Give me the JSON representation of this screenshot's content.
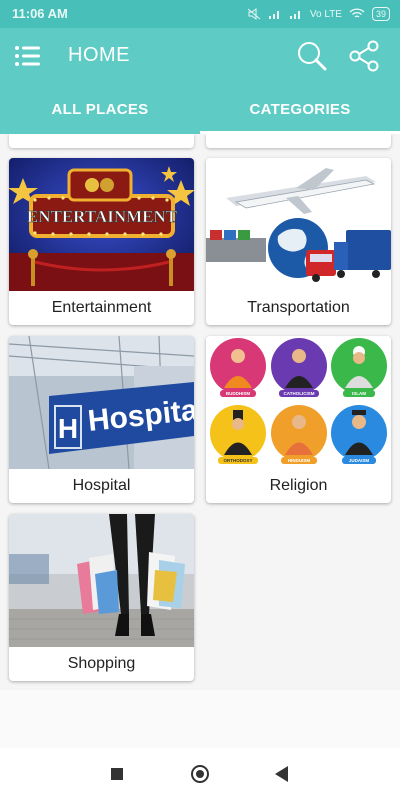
{
  "status_bar": {
    "time": "11:06 AM",
    "battery": "39",
    "network": "Vo LTE"
  },
  "toolbar": {
    "title": "HOME"
  },
  "tabs": [
    {
      "label": "ALL PLACES"
    },
    {
      "label": "CATEGORIES"
    }
  ],
  "colors": {
    "accent": "#5ecbc4",
    "status": "#48bfb8"
  },
  "categories": [
    {
      "label": "Entertainment",
      "banner": "ENTERTAINMENT"
    },
    {
      "label": "Transportation"
    },
    {
      "label": "Hospital",
      "sign": "Hospital"
    },
    {
      "label": "Religion",
      "tags": [
        "BUDDHISM",
        "CATHOLICISM",
        "ISLAM",
        "ORTHODOXY",
        "HINDUISM",
        "JUDAISM"
      ]
    },
    {
      "label": "Shopping"
    }
  ]
}
